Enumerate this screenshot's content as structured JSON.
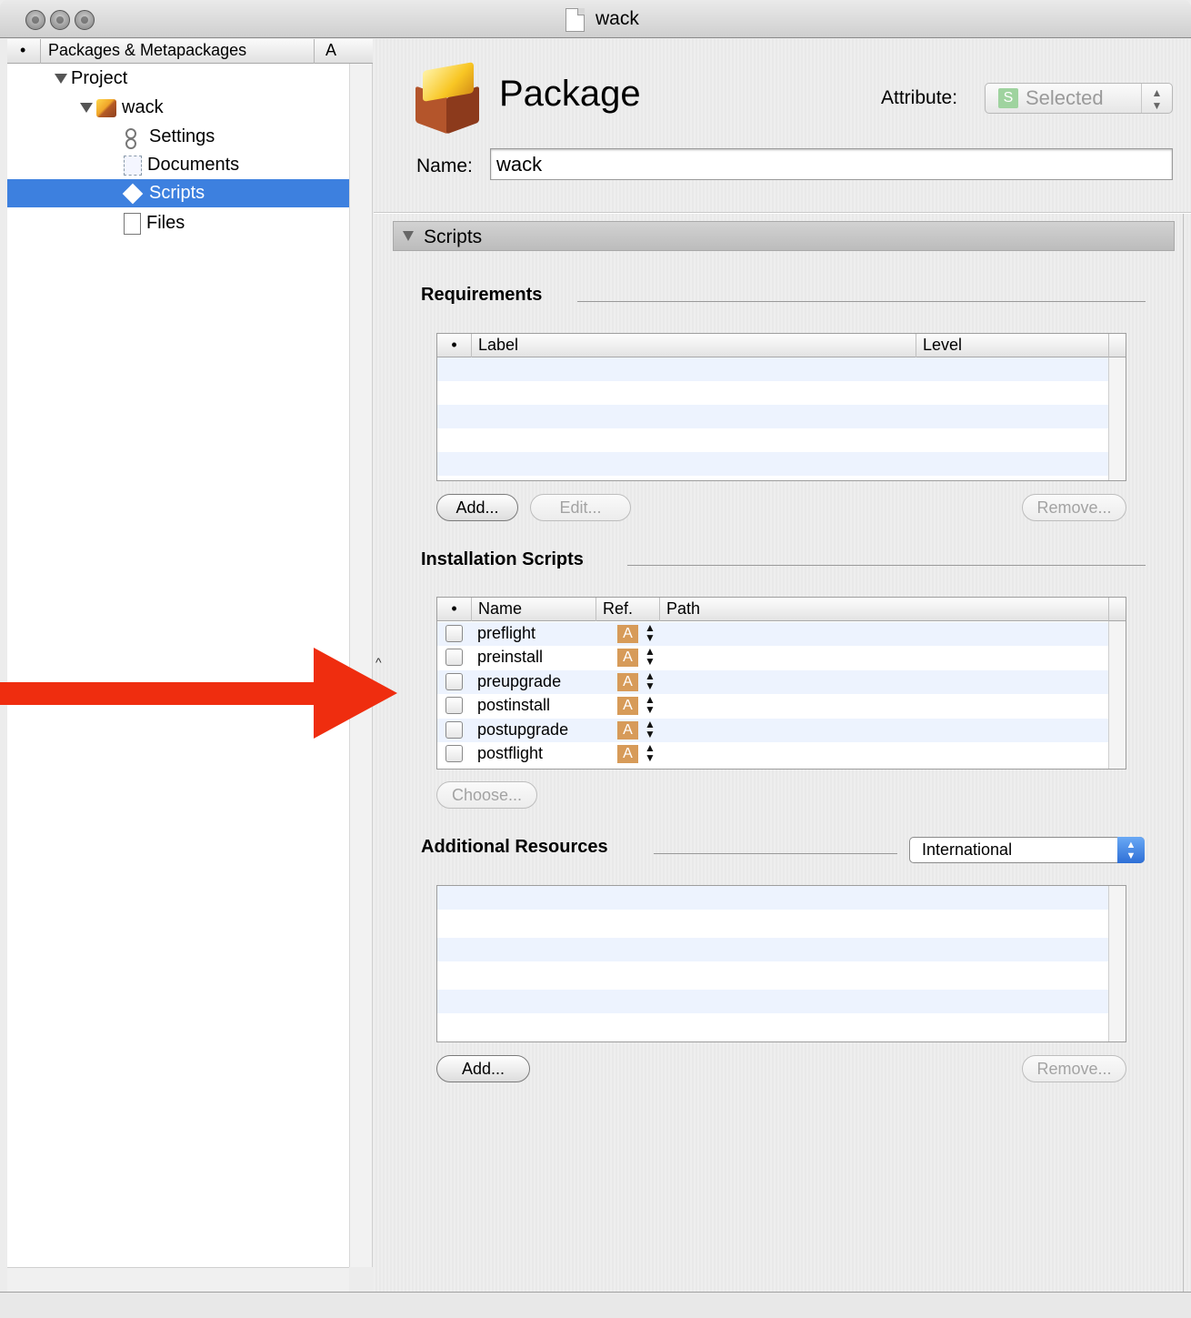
{
  "window": {
    "title": "wack"
  },
  "sidebar": {
    "header": {
      "dot": "•",
      "title": "Packages & Metapackages",
      "column_a": "A"
    },
    "items": [
      {
        "label": "Project"
      },
      {
        "label": "wack"
      },
      {
        "label": "Settings"
      },
      {
        "label": "Documents"
      },
      {
        "label": "Scripts",
        "selected": true
      },
      {
        "label": "Files"
      }
    ]
  },
  "header": {
    "title": "Package",
    "attribute_label": "Attribute:",
    "attribute_badge": "S",
    "attribute_value": "Selected",
    "name_label": "Name:",
    "name_value": "wack"
  },
  "section": {
    "title": "Scripts"
  },
  "requirements": {
    "title": "Requirements",
    "columns": {
      "dot": "•",
      "label": "Label",
      "level": "Level"
    },
    "add_label": "Add...",
    "edit_label": "Edit...",
    "remove_label": "Remove..."
  },
  "installation_scripts": {
    "title": "Installation Scripts",
    "columns": {
      "dot": "•",
      "name": "Name",
      "ref": "Ref.",
      "path": "Path"
    },
    "rows": [
      {
        "name": "preflight",
        "ref": "A"
      },
      {
        "name": "preinstall",
        "ref": "A"
      },
      {
        "name": "preupgrade",
        "ref": "A"
      },
      {
        "name": "postinstall",
        "ref": "A"
      },
      {
        "name": "postupgrade",
        "ref": "A"
      },
      {
        "name": "postflight",
        "ref": "A"
      }
    ],
    "choose_label": "Choose..."
  },
  "additional_resources": {
    "title": "Additional Resources",
    "language": "International",
    "add_label": "Add...",
    "remove_label": "Remove..."
  },
  "colors": {
    "selection": "#3d80df",
    "annotation_arrow": "#ef2d0f",
    "ref_badge": "#d79b59"
  }
}
